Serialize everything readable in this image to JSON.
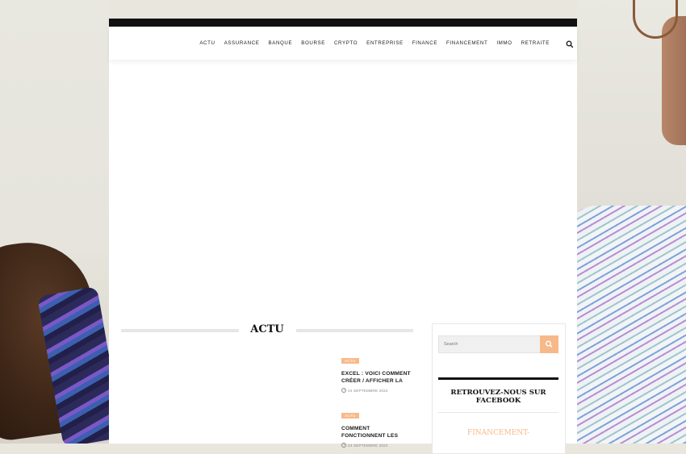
{
  "nav": {
    "menu": [
      "ACTU",
      "ASSURANCE",
      "BANQUE",
      "BOURSE",
      "CRYPTO",
      "ENTREPRISE",
      "FINANCE",
      "FINANCEMENT",
      "IMMO",
      "RETRAITE"
    ]
  },
  "section": {
    "title": "ACTU"
  },
  "articles": [
    {
      "category": "ACTU",
      "title_line1": "EXCEL : VOICI COMMENT",
      "title_line2": "CRÉER / AFFICHER LA",
      "date": "24 SEPTEMBRE 2022"
    },
    {
      "category": "ACTU",
      "title_line1": "COMMENT",
      "title_line2": "FONCTIONNENT LES",
      "date": "24 SEPTEMBRE 2022"
    }
  ],
  "sidebar": {
    "search_placeholder": "Search",
    "facebook_title_line1": "RETROUVEZ-NOUS SUR",
    "facebook_title_line2": "FACEBOOK",
    "facebook_link": "FINANCEMENT-"
  },
  "colors": {
    "accent": "#f7b98a",
    "topbar": "#111111",
    "text": "#111111"
  },
  "icons": {
    "search": "search-icon",
    "clock": "clock-icon"
  }
}
